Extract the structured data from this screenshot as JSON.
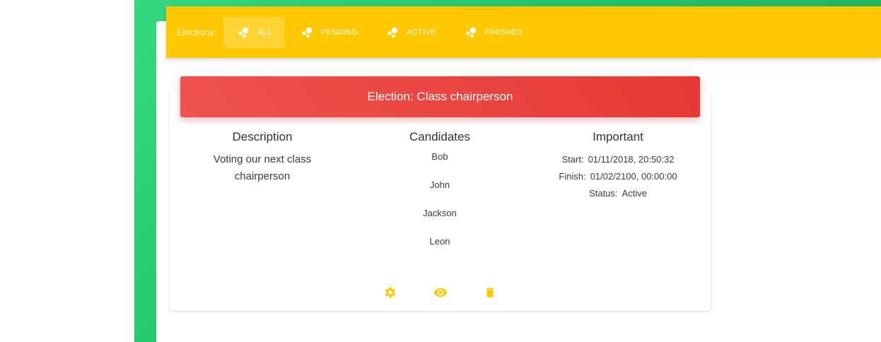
{
  "filter_bar": {
    "label": "Elections:",
    "items": [
      {
        "label": "ALL",
        "icon": "bubbles-icon",
        "active": true
      },
      {
        "label": "PENDING",
        "icon": "bubbles-icon",
        "active": false
      },
      {
        "label": "ACTIVE",
        "icon": "bubbles-icon",
        "active": false
      },
      {
        "label": "FINISHED",
        "icon": "bubbles-icon",
        "active": false
      }
    ]
  },
  "election_card": {
    "title": "Election: Class chairperson",
    "description": {
      "heading": "Description",
      "text": "Voting our next class chairperson"
    },
    "candidates": {
      "heading": "Candidates",
      "names": [
        "Bob",
        "John",
        "Jackson",
        "Leon"
      ]
    },
    "important": {
      "heading": "Important",
      "start_label": "Start:",
      "start_value": "01/11/2018, 20:50:32",
      "finish_label": "Finish:",
      "finish_value": "01/02/2100, 00:00:00",
      "status_label": "Status:",
      "status_value": "Active"
    },
    "actions": [
      {
        "icon": "gear-icon"
      },
      {
        "icon": "eye-icon"
      },
      {
        "icon": "trash-icon"
      }
    ]
  },
  "colors": {
    "accent_yellow": "#ffc800",
    "header_red": "#e53935",
    "background_green": "#22c269"
  }
}
